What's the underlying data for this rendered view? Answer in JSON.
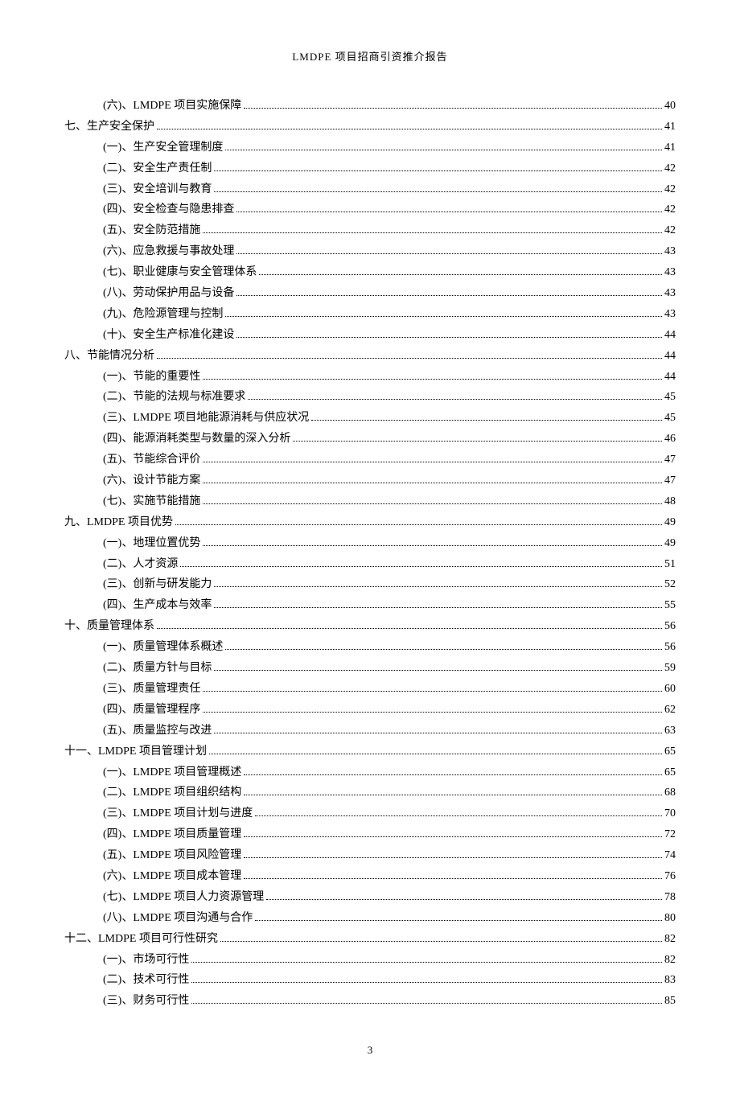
{
  "header": {
    "title": "LMDPE 项目招商引资推介报告"
  },
  "toc": [
    {
      "level": 2,
      "label": "(六)、LMDPE 项目实施保障",
      "page": "40"
    },
    {
      "level": 1,
      "label": "七、生产安全保护",
      "page": "41"
    },
    {
      "level": 2,
      "label": "(一)、生产安全管理制度",
      "page": "41"
    },
    {
      "level": 2,
      "label": "(二)、安全生产责任制",
      "page": "42"
    },
    {
      "level": 2,
      "label": "(三)、安全培训与教育",
      "page": "42"
    },
    {
      "level": 2,
      "label": "(四)、安全检查与隐患排查",
      "page": "42"
    },
    {
      "level": 2,
      "label": "(五)、安全防范措施",
      "page": "42"
    },
    {
      "level": 2,
      "label": "(六)、应急救援与事故处理",
      "page": "43"
    },
    {
      "level": 2,
      "label": "(七)、职业健康与安全管理体系",
      "page": "43"
    },
    {
      "level": 2,
      "label": "(八)、劳动保护用品与设备",
      "page": "43"
    },
    {
      "level": 2,
      "label": "(九)、危险源管理与控制",
      "page": "43"
    },
    {
      "level": 2,
      "label": "(十)、安全生产标准化建设",
      "page": "44"
    },
    {
      "level": 1,
      "label": "八、节能情况分析",
      "page": "44"
    },
    {
      "level": 2,
      "label": "(一)、节能的重要性",
      "page": "44"
    },
    {
      "level": 2,
      "label": "(二)、节能的法规与标准要求",
      "page": "45"
    },
    {
      "level": 2,
      "label": "(三)、LMDPE 项目地能源消耗与供应状况",
      "page": "45"
    },
    {
      "level": 2,
      "label": "(四)、能源消耗类型与数量的深入分析",
      "page": "46"
    },
    {
      "level": 2,
      "label": "(五)、节能综合评价",
      "page": "47"
    },
    {
      "level": 2,
      "label": "(六)、设计节能方案",
      "page": "47"
    },
    {
      "level": 2,
      "label": "(七)、实施节能措施",
      "page": "48"
    },
    {
      "level": 1,
      "label": "九、LMDPE 项目优势",
      "page": "49"
    },
    {
      "level": 2,
      "label": "(一)、地理位置优势",
      "page": "49"
    },
    {
      "level": 2,
      "label": "(二)、人才资源",
      "page": "51"
    },
    {
      "level": 2,
      "label": "(三)、创新与研发能力",
      "page": "52"
    },
    {
      "level": 2,
      "label": "(四)、生产成本与效率",
      "page": "55"
    },
    {
      "level": 1,
      "label": "十、质量管理体系",
      "page": "56"
    },
    {
      "level": 2,
      "label": "(一)、质量管理体系概述",
      "page": "56"
    },
    {
      "level": 2,
      "label": "(二)、质量方针与目标",
      "page": "59"
    },
    {
      "level": 2,
      "label": "(三)、质量管理责任",
      "page": "60"
    },
    {
      "level": 2,
      "label": "(四)、质量管理程序",
      "page": "62"
    },
    {
      "level": 2,
      "label": "(五)、质量监控与改进",
      "page": "63"
    },
    {
      "level": 1,
      "label": "十一、LMDPE 项目管理计划",
      "page": "65"
    },
    {
      "level": 2,
      "label": "(一)、LMDPE 项目管理概述",
      "page": "65"
    },
    {
      "level": 2,
      "label": "(二)、LMDPE 项目组织结构",
      "page": "68"
    },
    {
      "level": 2,
      "label": "(三)、LMDPE 项目计划与进度",
      "page": "70"
    },
    {
      "level": 2,
      "label": "(四)、LMDPE 项目质量管理",
      "page": "72"
    },
    {
      "level": 2,
      "label": "(五)、LMDPE 项目风险管理",
      "page": "74"
    },
    {
      "level": 2,
      "label": "(六)、LMDPE 项目成本管理",
      "page": "76"
    },
    {
      "level": 2,
      "label": "(七)、LMDPE 项目人力资源管理",
      "page": "78"
    },
    {
      "level": 2,
      "label": "(八)、LMDPE 项目沟通与合作",
      "page": "80"
    },
    {
      "level": 1,
      "label": "十二、LMDPE 项目可行性研究",
      "page": "82"
    },
    {
      "level": 2,
      "label": "(一)、市场可行性",
      "page": "82"
    },
    {
      "level": 2,
      "label": "(二)、技术可行性",
      "page": "83"
    },
    {
      "level": 2,
      "label": "(三)、财务可行性",
      "page": "85"
    }
  ],
  "footer": {
    "page_number": "3"
  }
}
